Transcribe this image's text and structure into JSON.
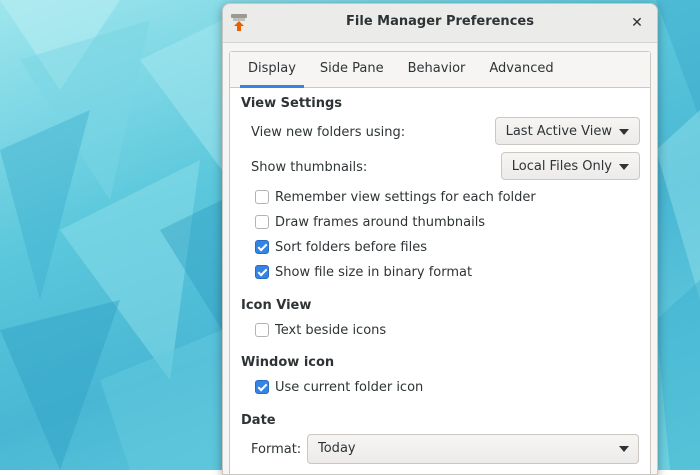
{
  "window": {
    "title": "File Manager Preferences",
    "close_symbol": "✕"
  },
  "tabs": [
    {
      "label": "Display",
      "active": true
    },
    {
      "label": "Side Pane",
      "active": false
    },
    {
      "label": "Behavior",
      "active": false
    },
    {
      "label": "Advanced",
      "active": false
    }
  ],
  "view_settings": {
    "heading": "View Settings",
    "new_folders_label": "View new folders using:",
    "new_folders_value": "Last Active View",
    "thumbnails_label": "Show thumbnails:",
    "thumbnails_value": "Local Files Only",
    "options": [
      {
        "label": "Remember view settings for each folder",
        "checked": false
      },
      {
        "label": "Draw frames around thumbnails",
        "checked": false
      },
      {
        "label": "Sort folders before files",
        "checked": true
      },
      {
        "label": "Show file size in binary format",
        "checked": true
      }
    ]
  },
  "icon_view": {
    "heading": "Icon View",
    "options": [
      {
        "label": "Text beside icons",
        "checked": false
      }
    ]
  },
  "window_icon": {
    "heading": "Window icon",
    "options": [
      {
        "label": "Use current folder icon",
        "checked": true
      }
    ]
  },
  "date": {
    "heading": "Date",
    "format_label": "Format:",
    "format_value": "Today"
  },
  "colors": {
    "accent": "#3584e4",
    "window_bg": "#f6f5f4",
    "wallpaper": "#5cc8dc"
  },
  "icons": {
    "app": "file-manager-app-icon",
    "close": "close-icon",
    "dropdown": "chevron-down-icon",
    "check": "checkmark-icon"
  }
}
